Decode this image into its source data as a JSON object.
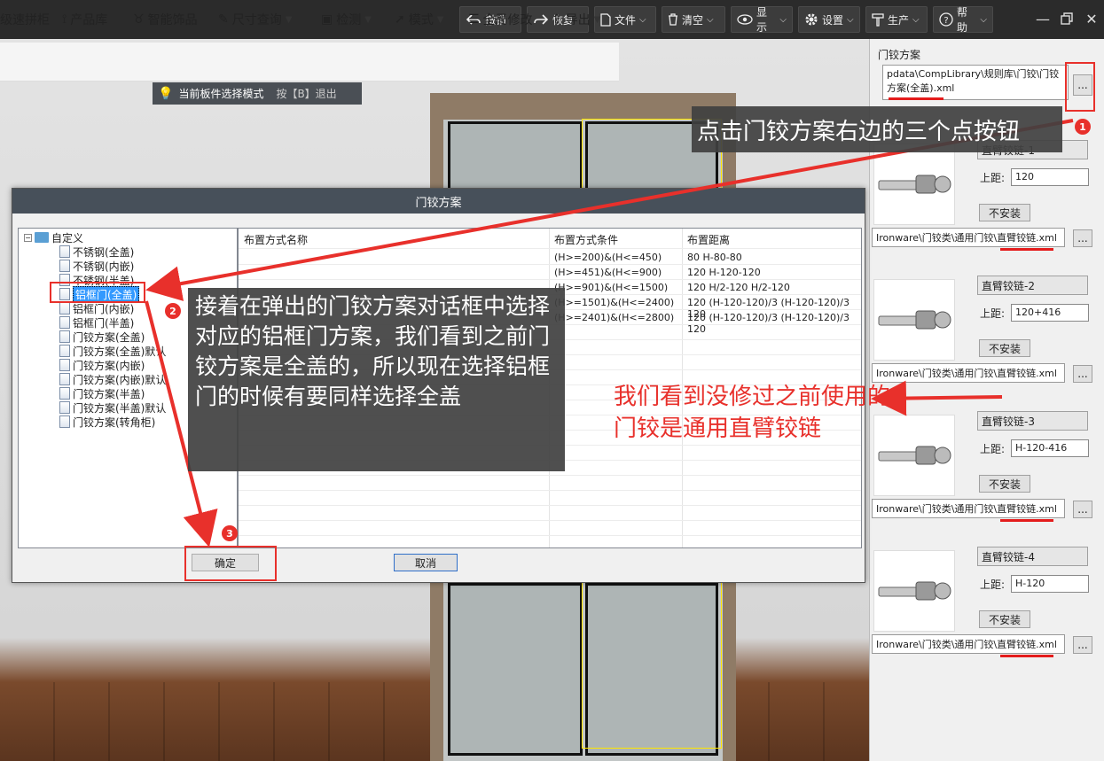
{
  "topbar": {
    "buttons": [
      {
        "label": "撤销",
        "icon": "undo-icon"
      },
      {
        "label": "恢复",
        "icon": "redo-icon"
      },
      {
        "label": "文件",
        "icon": "file-icon"
      },
      {
        "label": "清空",
        "icon": "trash-icon"
      },
      {
        "label": "显示",
        "icon": "eye-icon"
      },
      {
        "label": "设置",
        "icon": "gear-icon"
      },
      {
        "label": "生产",
        "icon": "hammer-icon"
      },
      {
        "label": "帮助",
        "icon": "help-icon"
      }
    ],
    "window_controls": [
      "minimize-icon",
      "restore-icon",
      "close-icon"
    ]
  },
  "toolbar": {
    "items": [
      {
        "label": "级速拼柜"
      },
      {
        "label": "产品库"
      },
      {
        "label": "智能饰品"
      },
      {
        "label": "尺寸查询"
      },
      {
        "label": "检测"
      },
      {
        "label": "模式"
      },
      {
        "label": "全局修改"
      },
      {
        "label": "导出"
      }
    ]
  },
  "mode_tip": {
    "text": "当前板件选择模式",
    "hint": "按【B】退出"
  },
  "right_panel": {
    "title": "门铰方案",
    "scheme_path_line1": "pdata\\CompLibrary\\规则库\\门铰\\门铰",
    "scheme_path_line2": "方案(全盖).xml",
    "dots": "...",
    "hinges": [
      {
        "name": "直臂铰链-1",
        "distance_label": "上距:",
        "distance": "120",
        "uninstall": "不安装",
        "path": "Ironware\\门铰类\\通用门铰\\直臂铰链.xml"
      },
      {
        "name": "直臂铰链-2",
        "distance_label": "上距:",
        "distance": "120+416",
        "uninstall": "不安装",
        "path": "Ironware\\门铰类\\通用门铰\\直臂铰链.xml"
      },
      {
        "name": "直臂铰链-3",
        "distance_label": "上距:",
        "distance": "H-120-416",
        "uninstall": "不安装",
        "path": "Ironware\\门铰类\\通用门铰\\直臂铰链.xml"
      },
      {
        "name": "直臂铰链-4",
        "distance_label": "上距:",
        "distance": "H-120",
        "uninstall": "不安装",
        "path": "Ironware\\门铰类\\通用门铰\\直臂铰链.xml"
      }
    ]
  },
  "dialog": {
    "title": "门铰方案",
    "tree_root": "自定义",
    "tree_items": [
      "不锈钢(全盖)",
      "不锈钢(内嵌)",
      "不锈钢(半盖)",
      "铝框门(全盖)",
      "铝框门(内嵌)",
      "铝框门(半盖)",
      "门铰方案(全盖)",
      "门铰方案(全盖)默认",
      "门铰方案(内嵌)",
      "门铰方案(内嵌)默认",
      "门铰方案(半盖)",
      "门铰方案(半盖)默认",
      "门铰方案(转角柜)"
    ],
    "selected_item": "铝框门(全盖)",
    "columns": [
      "布置方式名称",
      "布置方式条件",
      "布置距离"
    ],
    "rows": [
      {
        "condition": "(H>=200)&(H<=450)",
        "distance": "80 H-80-80"
      },
      {
        "condition": "(H>=451)&(H<=900)",
        "distance": "120 H-120-120"
      },
      {
        "condition": "(H>=901)&(H<=1500)",
        "distance": "120 H/2-120 H/2-120"
      },
      {
        "condition": "(H>=1501)&(H<=2400)",
        "distance": "120 (H-120-120)/3 (H-120-120)/3 120"
      },
      {
        "condition": "(H>=2401)&(H<=2800)",
        "distance": "120 (H-120-120)/3 (H-120-120)/3 120"
      }
    ],
    "ok": "确定",
    "cancel": "取消"
  },
  "annotations": {
    "step1": "点击门铰方案右边的三个点按钮",
    "step2": "接着在弹出的门铰方案对话框中选择对应的铝框门方案，我们看到之前门铰方案是全盖的，所以现在选择铝框门的时候有要同样选择全盖",
    "note_hinge": "我们看到没修过之前使用的门铰是通用直臂铰链",
    "badge1": "1",
    "badge2": "2",
    "badge3": "3"
  },
  "colors": {
    "annotation_red": "#e8302b",
    "topbar": "#2b2b2b",
    "selection_blue": "#3399ff"
  }
}
